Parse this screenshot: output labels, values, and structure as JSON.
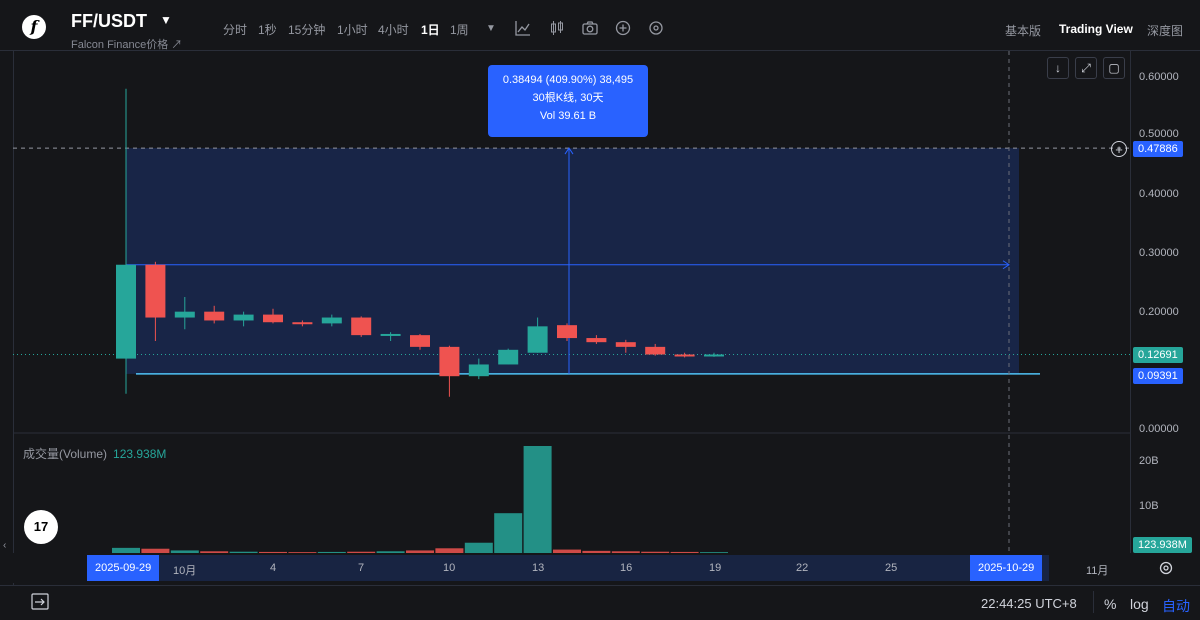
{
  "header": {
    "logo_glyph": "f",
    "pair": "FF/USDT",
    "subtitle": "Falcon Finance价格 ↗",
    "timeframes": [
      "分时",
      "1秒",
      "15分钟",
      "1小时",
      "4小时",
      "1日",
      "1周"
    ],
    "active_timeframe": "1日",
    "views": [
      "基本版",
      "Trading View",
      "深度图"
    ],
    "active_view": "Trading View"
  },
  "tooltip": {
    "line1": "0.38494 (409.90%) 38,495",
    "line2": "30根K线, 30天",
    "line3": "Vol 39.61 B"
  },
  "price_axis": [
    "0.60000",
    "0.50000",
    "0.40000",
    "0.30000",
    "0.20000",
    "0.00000"
  ],
  "price_tags": {
    "measure_top": "0.47886",
    "current": "0.12691",
    "measure_bottom": "0.09391"
  },
  "volume": {
    "label": "成交量(Volume)",
    "value": "123.938M",
    "axis": [
      "20B",
      "10B"
    ],
    "tag": "123.938M"
  },
  "time_axis": {
    "start_box": "2025-09-29",
    "end_box": "2025-10-29",
    "labels": [
      "10月",
      "4",
      "7",
      "10",
      "13",
      "16",
      "19",
      "22",
      "25",
      "11月"
    ]
  },
  "footer": {
    "clock": "22:44:25 UTC+8",
    "percent": "%",
    "log": "log",
    "auto": "自动"
  },
  "colors": {
    "up": "#26a69a",
    "down": "#ef5350",
    "accent": "#2962ff"
  },
  "chart_data": {
    "type": "candlestick",
    "price_ylim": [
      0,
      0.65
    ],
    "volume_unit": "B",
    "volume_ylim": [
      0,
      25
    ],
    "candles": [
      {
        "o": 0.12,
        "h": 0.58,
        "l": 0.06,
        "c": 0.28,
        "v": 1.2
      },
      {
        "o": 0.28,
        "h": 0.285,
        "l": 0.15,
        "c": 0.19,
        "v": 1.0
      },
      {
        "o": 0.19,
        "h": 0.225,
        "l": 0.17,
        "c": 0.2,
        "v": 0.6
      },
      {
        "o": 0.2,
        "h": 0.21,
        "l": 0.18,
        "c": 0.185,
        "v": 0.4
      },
      {
        "o": 0.185,
        "h": 0.2,
        "l": 0.175,
        "c": 0.195,
        "v": 0.3
      },
      {
        "o": 0.195,
        "h": 0.205,
        "l": 0.18,
        "c": 0.182,
        "v": 0.25
      },
      {
        "o": 0.182,
        "h": 0.185,
        "l": 0.175,
        "c": 0.179,
        "v": 0.2
      },
      {
        "o": 0.18,
        "h": 0.195,
        "l": 0.175,
        "c": 0.19,
        "v": 0.25
      },
      {
        "o": 0.19,
        "h": 0.192,
        "l": 0.157,
        "c": 0.16,
        "v": 0.3
      },
      {
        "o": 0.16,
        "h": 0.165,
        "l": 0.15,
        "c": 0.162,
        "v": 0.4
      },
      {
        "o": 0.16,
        "h": 0.162,
        "l": 0.135,
        "c": 0.14,
        "v": 0.6
      },
      {
        "o": 0.14,
        "h": 0.142,
        "l": 0.055,
        "c": 0.09,
        "v": 1.1
      },
      {
        "o": 0.09,
        "h": 0.12,
        "l": 0.085,
        "c": 0.11,
        "v": 2.4
      },
      {
        "o": 0.11,
        "h": 0.137,
        "l": 0.11,
        "c": 0.135,
        "v": 9.3
      },
      {
        "o": 0.13,
        "h": 0.19,
        "l": 0.13,
        "c": 0.175,
        "v": 25.0
      },
      {
        "o": 0.177,
        "h": 0.18,
        "l": 0.15,
        "c": 0.155,
        "v": 0.8
      },
      {
        "o": 0.155,
        "h": 0.16,
        "l": 0.145,
        "c": 0.148,
        "v": 0.5
      },
      {
        "o": 0.148,
        "h": 0.152,
        "l": 0.13,
        "c": 0.14,
        "v": 0.4
      },
      {
        "o": 0.14,
        "h": 0.145,
        "l": 0.125,
        "c": 0.127,
        "v": 0.3
      },
      {
        "o": 0.127,
        "h": 0.13,
        "l": 0.122,
        "c": 0.125,
        "v": 0.25
      },
      {
        "o": 0.125,
        "h": 0.13,
        "l": 0.123,
        "c": 0.127,
        "v": 0.2
      }
    ]
  }
}
